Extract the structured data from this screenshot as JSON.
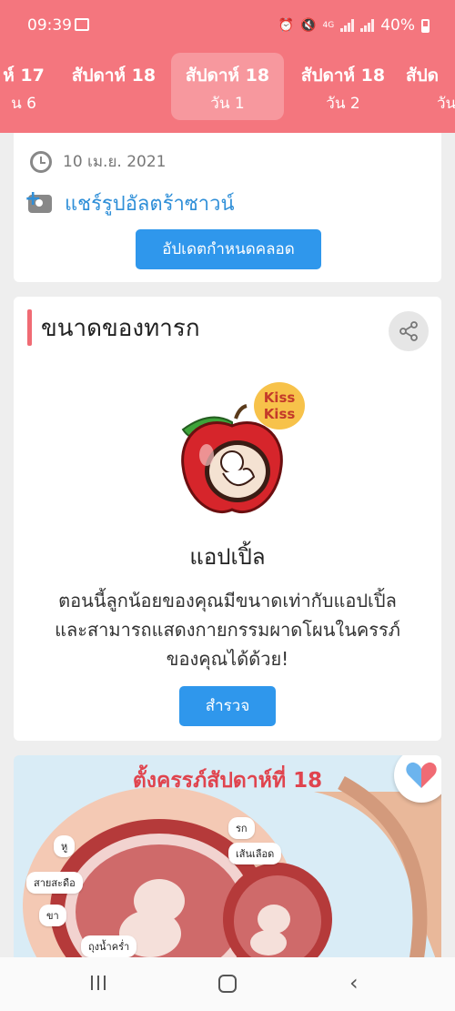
{
  "status_bar": {
    "time": "09:39",
    "network": "4G",
    "battery": "40%",
    "icons": [
      "image-icon",
      "alarm-icon",
      "mute-icon",
      "signal-icon",
      "battery-icon"
    ]
  },
  "week_tabs": [
    {
      "week": "ห์ 17",
      "day": "น 6"
    },
    {
      "week": "สัปดาห์ 18",
      "day": ""
    },
    {
      "week": "สัปดาห์ 18",
      "day": "วัน 1",
      "active": true
    },
    {
      "week": "สัปดาห์ 18",
      "day": "วัน 2"
    },
    {
      "week": "สัปด",
      "day": "วัน"
    }
  ],
  "due_card": {
    "date": "10 เม.ย. 2021",
    "share_ultrasound": "แชร์รูปอัลตร้าซาวน์",
    "update_button": "อัปเดตกำหนดคลอด"
  },
  "baby_size_card": {
    "title": "ขนาดของทารก",
    "fruit_name": "แอปเปิ้ล",
    "description": "ตอนนี้ลูกน้อยของคุณมีขนาดเท่ากับแอปเปิ้ล และสามารถแสดงกายกรรมผาดโผนในครรภ์ของคุณได้ด้วย!",
    "explore_button": "สำรวจ",
    "illustration_text": [
      "Kiss",
      "Kiss"
    ]
  },
  "infographic_card": {
    "title": "ตั้งครรภ์สัปดาห์ที่ 18",
    "labels": [
      "หู",
      "สายสะดือ",
      "ขา",
      "ถุงน้ำคร่ำ",
      "รก",
      "เส้นเลือด"
    ]
  },
  "colors": {
    "header": "#f4767e",
    "accent_blue": "#2f97ec",
    "link_blue": "#2f8fd8",
    "section_bar": "#f06b74"
  }
}
